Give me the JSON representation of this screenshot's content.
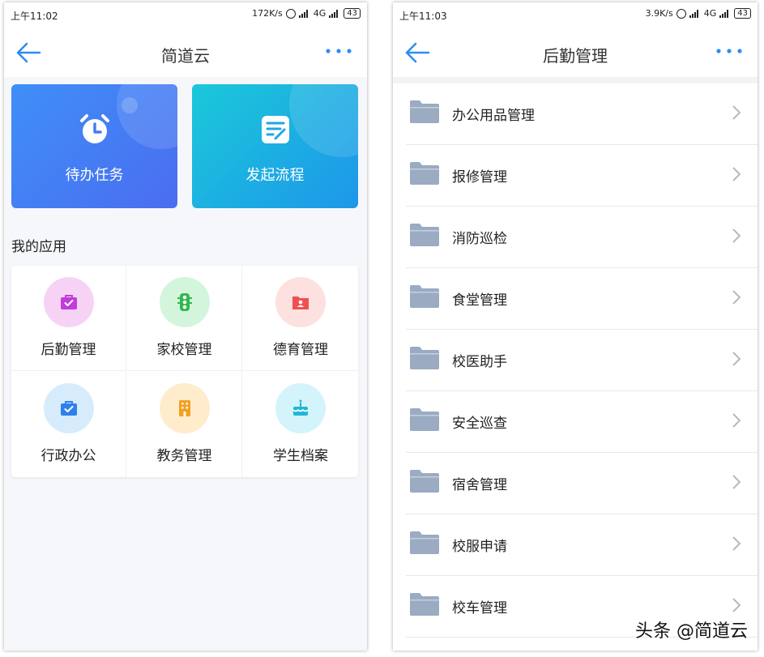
{
  "left": {
    "status": {
      "time": "上午11:02",
      "speed": "172K/s",
      "network": "4G",
      "battery": "43"
    },
    "nav": {
      "title": "简道云"
    },
    "cards": {
      "todo": "待办任务",
      "flow": "发起流程"
    },
    "section_title": "我的应用",
    "apps": [
      {
        "label": "后勤管理",
        "icon": "briefcase-check-icon",
        "bg": "#f6d3f5",
        "fg": "#c13cd8"
      },
      {
        "label": "家校管理",
        "icon": "traffic-light-icon",
        "bg": "#d3f5dc",
        "fg": "#2fb84f"
      },
      {
        "label": "德育管理",
        "icon": "person-folder-icon",
        "bg": "#fde0e0",
        "fg": "#f05050"
      },
      {
        "label": "行政办公",
        "icon": "briefcase-check-icon",
        "bg": "#d6ecfd",
        "fg": "#2f80ed"
      },
      {
        "label": "教务管理",
        "icon": "building-icon",
        "bg": "#feeccc",
        "fg": "#f5a021"
      },
      {
        "label": "学生档案",
        "icon": "cake-icon",
        "bg": "#d4f4fb",
        "fg": "#1fb6d6"
      }
    ]
  },
  "right": {
    "status": {
      "time": "上午11:03",
      "speed": "3.9K/s",
      "network": "4G",
      "battery": "43"
    },
    "nav": {
      "title": "后勤管理"
    },
    "items": [
      "办公用品管理",
      "报修管理",
      "消防巡检",
      "食堂管理",
      "校医助手",
      "安全巡查",
      "宿舍管理",
      "校服申请",
      "校车管理"
    ]
  },
  "watermark": "头条 @简道云",
  "colors": {
    "accent": "#2d8cf0",
    "folder": "#9aabc2"
  }
}
